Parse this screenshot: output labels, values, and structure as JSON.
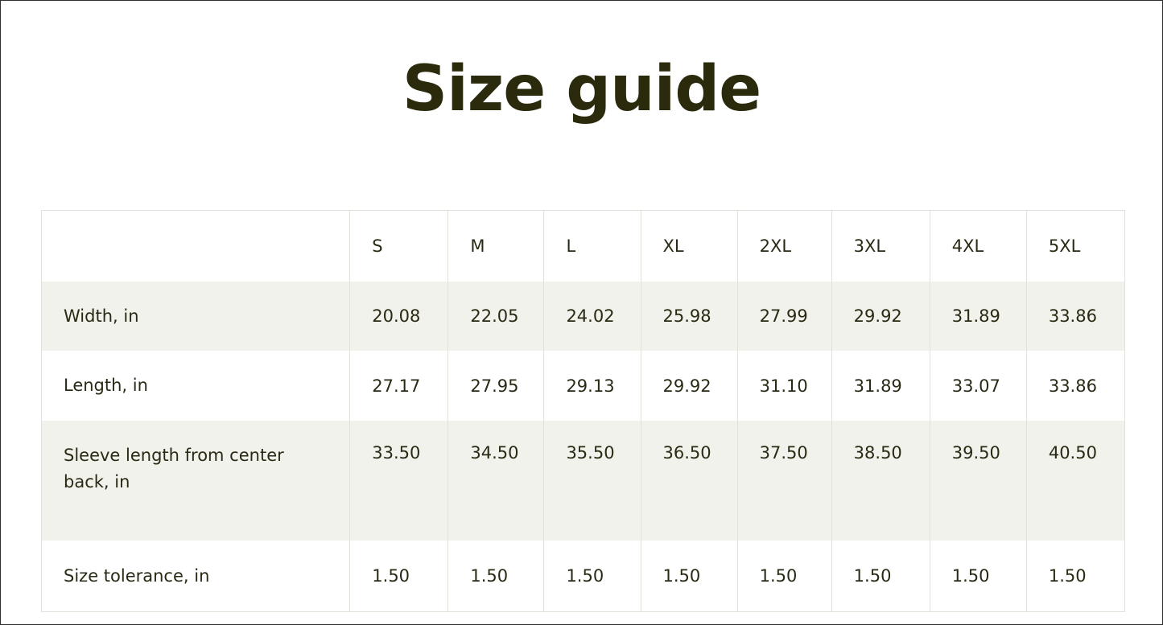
{
  "title": "Size guide",
  "colors": {
    "title_text": "#2b2a0c",
    "body_text": "#2a2a14",
    "row_shade": "#f2f2ec",
    "grid_line": "#e2e1d9"
  },
  "table": {
    "sizes": [
      "S",
      "M",
      "L",
      "XL",
      "2XL",
      "3XL",
      "4XL",
      "5XL"
    ],
    "rows": [
      {
        "label": "Width, in",
        "values": [
          "20.08",
          "22.05",
          "24.02",
          "25.98",
          "27.99",
          "29.92",
          "31.89",
          "33.86"
        ]
      },
      {
        "label": "Length, in",
        "values": [
          "27.17",
          "27.95",
          "29.13",
          "29.92",
          "31.10",
          "31.89",
          "33.07",
          "33.86"
        ]
      },
      {
        "label": "Sleeve length from center back, in",
        "values": [
          "33.50",
          "34.50",
          "35.50",
          "36.50",
          "37.50",
          "38.50",
          "39.50",
          "40.50"
        ]
      },
      {
        "label": "Size tolerance, in",
        "values": [
          "1.50",
          "1.50",
          "1.50",
          "1.50",
          "1.50",
          "1.50",
          "1.50",
          "1.50"
        ]
      }
    ]
  }
}
